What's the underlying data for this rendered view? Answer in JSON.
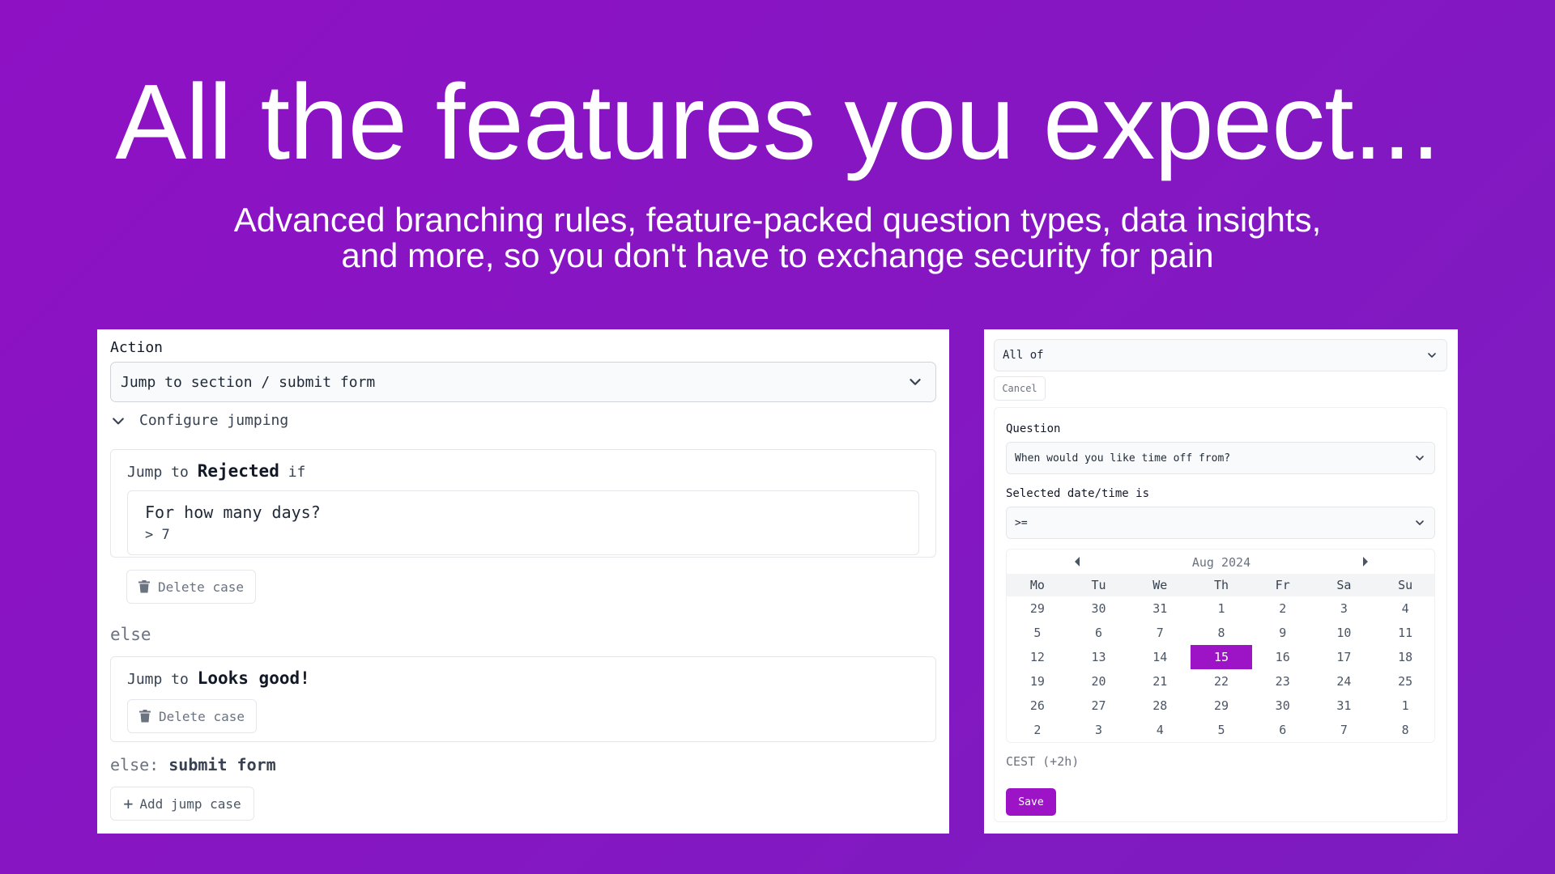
{
  "hero": {
    "title": "All the features you expect...",
    "subtitle_line1": "Advanced branching rules, feature-packed question types, data insights,",
    "subtitle_line2": "and more, so you don't have to exchange security for pain"
  },
  "colors": {
    "background": "#8e11c4",
    "accent": "#9d14c7"
  },
  "left_panel": {
    "action_label": "Action",
    "action_value": "Jump to section / submit form",
    "configure_label": "Configure jumping",
    "case1": {
      "jump_prefix": "Jump to",
      "target": "Rejected",
      "suffix": "if",
      "question": "For how many days?",
      "condition": "> 7",
      "delete_label": "Delete case"
    },
    "else_label": "else",
    "case2": {
      "jump_prefix": "Jump to",
      "target": "Looks good!",
      "delete_label": "Delete case"
    },
    "final_else_prefix": "else:",
    "final_else_action": "submit form",
    "add_label": "Add jump case"
  },
  "right_panel": {
    "combinator": "All of",
    "cancel_label": "Cancel",
    "question_label": "Question",
    "question_value": "When would you like time off from?",
    "selected_label": "Selected date/time is",
    "operator_value": ">=",
    "calendar": {
      "month": "Aug 2024",
      "weekdays": [
        "Mo",
        "Tu",
        "We",
        "Th",
        "Fr",
        "Sa",
        "Su"
      ],
      "days": [
        "29",
        "30",
        "31",
        "1",
        "2",
        "3",
        "4",
        "5",
        "6",
        "7",
        "8",
        "9",
        "10",
        "11",
        "12",
        "13",
        "14",
        "15",
        "16",
        "17",
        "18",
        "19",
        "20",
        "21",
        "22",
        "23",
        "24",
        "25",
        "26",
        "27",
        "28",
        "29",
        "30",
        "31",
        "1",
        "2",
        "3",
        "4",
        "5",
        "6",
        "7",
        "8"
      ],
      "selected_index": 17
    },
    "timezone": "CEST (+2h)",
    "save_label": "Save"
  }
}
